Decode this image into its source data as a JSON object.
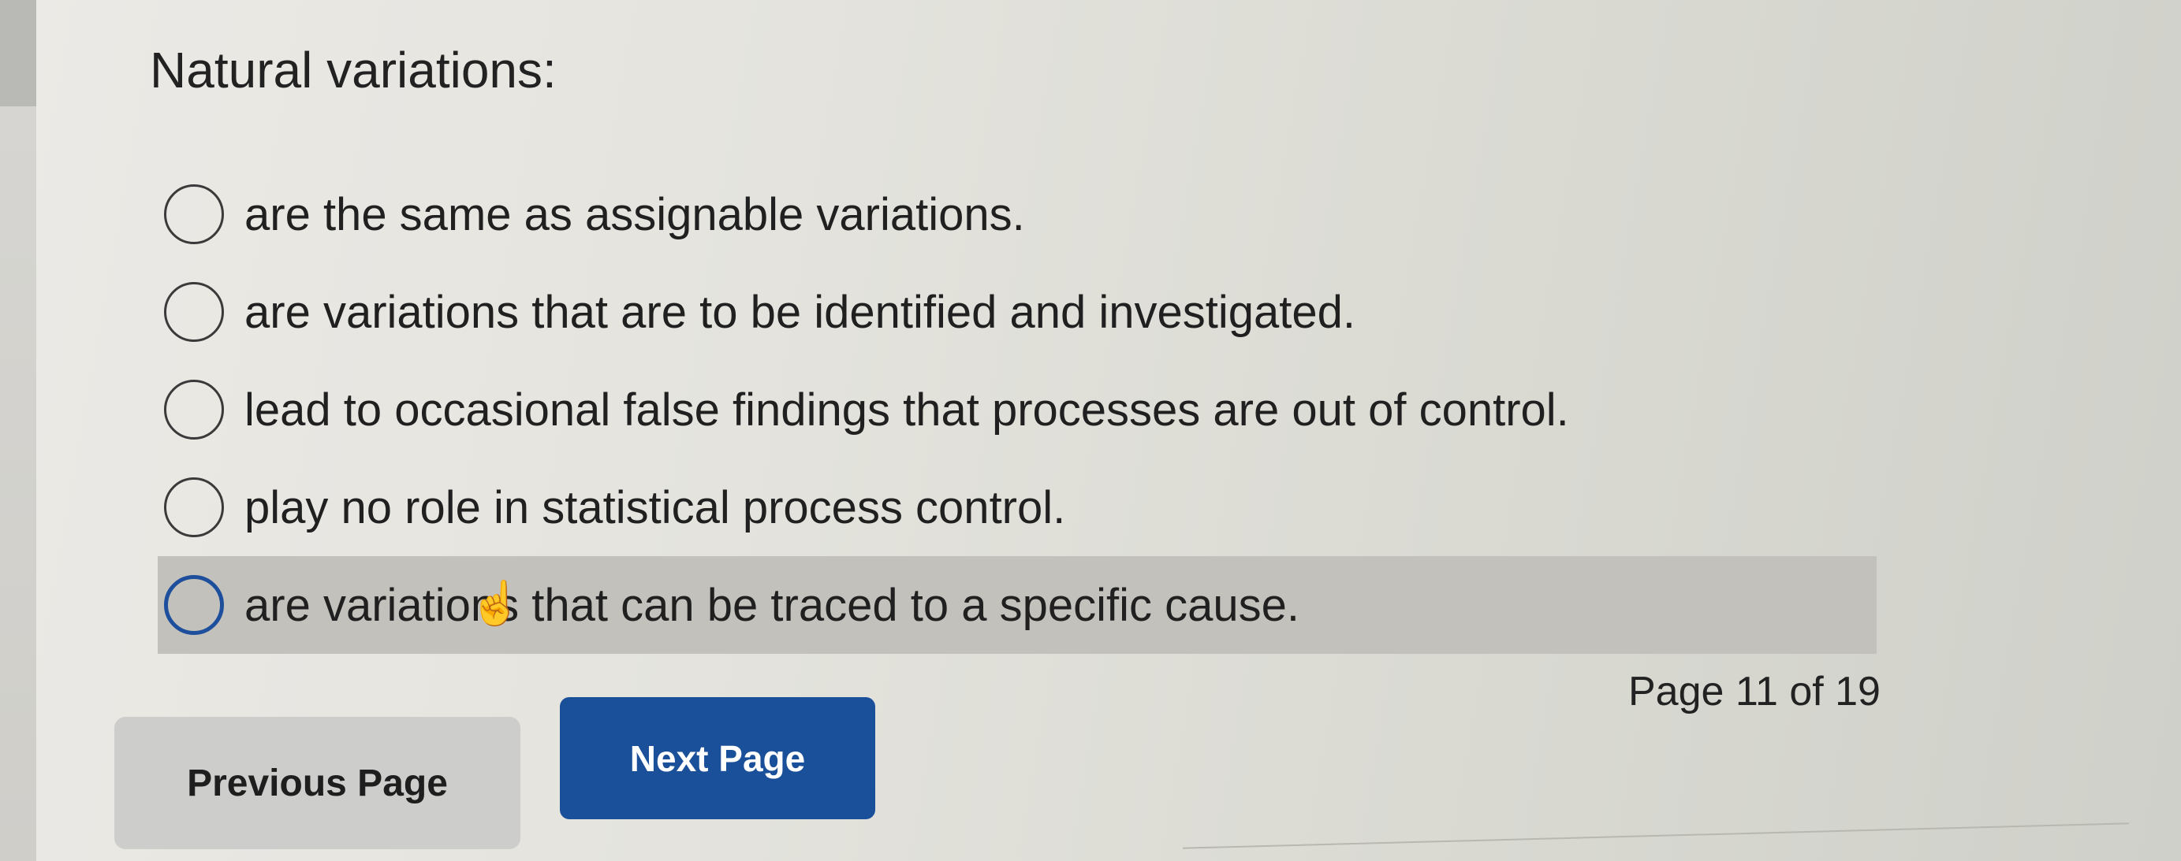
{
  "question": {
    "title": "Natural variations:"
  },
  "options": [
    {
      "label": "are the same as assignable variations."
    },
    {
      "label": "are variations that are to be identified and investigated."
    },
    {
      "label": "lead to occasional false findings that processes are out of control."
    },
    {
      "label": "play no role in statistical process control."
    },
    {
      "label": "are variations that can be traced to a specific cause."
    }
  ],
  "navigation": {
    "page_indicator": "Page 11 of 19",
    "previous_label": "Previous Page",
    "next_label": "Next Page"
  },
  "colors": {
    "next_button": "#1a4f9a",
    "hover_row": "#c3c1bc",
    "focused_radio": "#1d4f9c"
  },
  "icons": {
    "cursor": "hand-pointer-icon"
  }
}
